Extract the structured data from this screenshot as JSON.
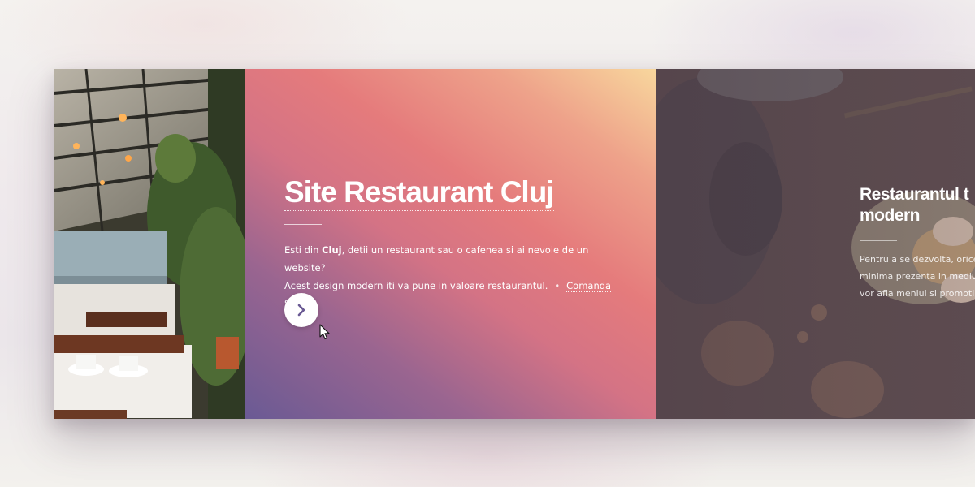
{
  "slides": {
    "main": {
      "title": "Site Restaurant Cluj",
      "description": {
        "line1_before": "Esti din ",
        "line1_bold": "Cluj",
        "line1_after": ", detii un restaurant sau o cafenea si ai nevoie de un website?",
        "line2": "Acest design modern iti va pune in valoare restaurantul.",
        "separator": "•",
        "cta_label": "Comanda Site"
      },
      "next_button_icon": "chevron-right-icon"
    },
    "right": {
      "title_line1": "Restaurantul t",
      "title_line2": "modern",
      "desc_line1": "Pentru a se dezvolta, orice",
      "desc_line2": "minima prezenta in mediu",
      "desc_line3": "vor afla meniul si promotii"
    }
  },
  "colors": {
    "main_gradient": [
      "#f8d79d",
      "#e57b7c",
      "#6a5a94"
    ],
    "text": "#ffffff"
  }
}
